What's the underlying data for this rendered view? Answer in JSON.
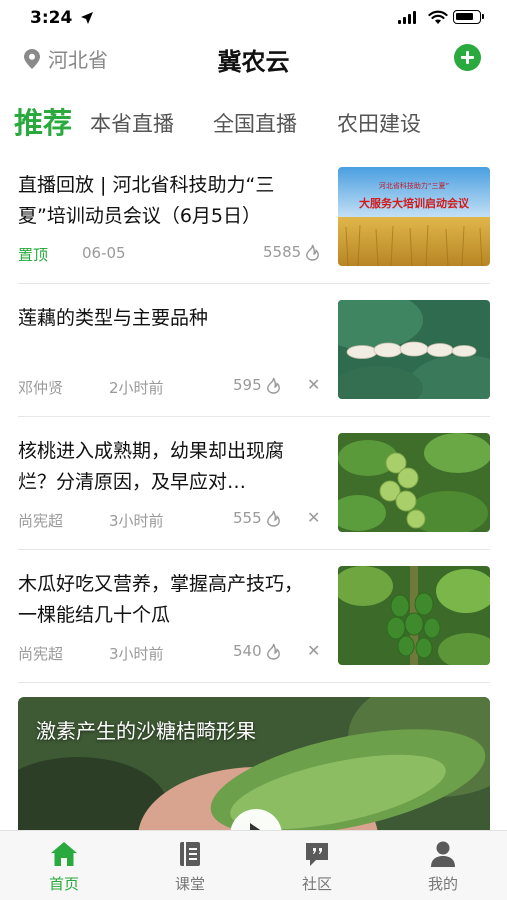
{
  "status_bar": {
    "time": "3:24",
    "battery_level": 0.8
  },
  "nav": {
    "location": "河北省",
    "title": "冀农云",
    "add_icon": "plus-circle-icon"
  },
  "tabs": [
    {
      "label": "推荐",
      "active": true
    },
    {
      "label": "本省直播",
      "active": false
    },
    {
      "label": "全国直播",
      "active": false
    },
    {
      "label": "农田建设",
      "active": false
    }
  ],
  "articles": [
    {
      "title": "直播回放 | 河北省科技助力“三夏”培训动员会议（6月5日）",
      "tag": "置顶",
      "time": "06-05",
      "views": "5585",
      "thumb_top_text": "河北省科技助力“三夏”",
      "thumb_main_text": "大服务大培训启动会议"
    },
    {
      "title": "莲藕的类型与主要品种",
      "author": "邓仲贤",
      "time": "2小时前",
      "views": "595"
    },
    {
      "title": "核桃进入成熟期，幼果却出现腐烂？分清原因，及早应对…",
      "author": "尚宪超",
      "time": "3小时前",
      "views": "555"
    },
    {
      "title": "木瓜好吃又营养，掌握高产技巧，一棵能结几十个瓜",
      "author": "尚宪超",
      "time": "3小时前",
      "views": "540"
    }
  ],
  "close_glyph": "✕",
  "video": {
    "title": "激素产生的沙糖桔畸形果"
  },
  "tabbar": [
    {
      "label": "首页",
      "icon": "home-icon",
      "active": true
    },
    {
      "label": "课堂",
      "icon": "book-icon",
      "active": false
    },
    {
      "label": "社区",
      "icon": "chat-bubble-icon",
      "active": false
    },
    {
      "label": "我的",
      "icon": "person-icon",
      "active": false
    }
  ],
  "colors": {
    "accent": "#2aaa3e",
    "muted_text": "#9a9a9a",
    "tabbar_bg": "#f7f7f7"
  }
}
